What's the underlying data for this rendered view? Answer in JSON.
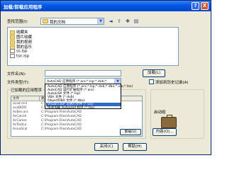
{
  "window": {
    "title": "加载/卸载应用程序",
    "help_label": "?",
    "close_label": "X"
  },
  "lookin": {
    "label": "查找范围(I):",
    "value": "我的文档"
  },
  "toolbar": {
    "back_icon": "back-arrow-icon",
    "up_icon": "up-folder-icon",
    "new_folder_icon": "new-folder-icon",
    "view_icon": "view-menu-icon"
  },
  "files": [
    {
      "name": "收藏夹",
      "icon": "folder-icon"
    },
    {
      "name": "图片收藏",
      "icon": "folder-icon"
    },
    {
      "name": "我的视频",
      "icon": "folder-icon"
    },
    {
      "name": "我的音乐",
      "icon": "music-folder-icon"
    },
    {
      "name": "ss.lsp",
      "icon": "file-icon"
    },
    {
      "name": "tsn.lsp",
      "icon": "file-icon"
    }
  ],
  "filename": {
    "label": "文件名(N):",
    "value": "",
    "load_button": "加载(L)"
  },
  "filetype": {
    "label": "文件类型(T):",
    "value": "AutoCAD 应用程序 (*.arx;*.lsp;*.dvb;*.",
    "options": [
      "AutoCAD 应用程序 (*.arx;*.lsp;*.dvb;*.dbx;*.vlx;*.fas)",
      "AutoCAD 运行扩展程序 (*.arx)",
      "AutoLISP 文件 (*.lsp)",
      "VBA 文件 (*.dvb)",
      "ObjectDBX 文件 (*.dbx)",
      "Visual LISP 可执行文件 (*.vlx)",
      "快速加载 AutoLISP 程序 (*.fas)"
    ],
    "selected_index": 5
  },
  "history_checkbox": "添加到历史记录(A)",
  "loaded_group": {
    "title": "已加载的应用程序",
    "columns": [
      "文件",
      "路径"
    ],
    "rows": [
      {
        "file": "acad.mnl",
        "path": "C:\\Program Files\\AutoCAD"
      },
      {
        "file": "acaDIOO",
        "path": "C:\\Program Files\\AutoCAD"
      },
      {
        "file": "AcBev.arx",
        "path": "C:\\Program Files\\AutoCAD"
      },
      {
        "file": "AcCalcUi",
        "path": "C:\\Program Files\\AutoCAD"
      },
      {
        "file": "AcCamer",
        "path": "C:\\Program Files\\AutoCAD"
      },
      {
        "file": "AcTextLa",
        "path": "C:\\Program Files\\AutoCAD"
      },
      {
        "file": "AnnoScal",
        "path": "C:\\Program Files\\AutoCAD"
      }
    ],
    "unload_button": "卸载(U)"
  },
  "startup_group": {
    "title": "启动组",
    "contents_button": "内容(O)..."
  },
  "bottom": {
    "close_button": "关闭(C)",
    "help_button": "帮助(H)"
  },
  "colors": {
    "titlebar": "#0058e6",
    "face": "#ece9d8",
    "selection": "#316ac5"
  }
}
